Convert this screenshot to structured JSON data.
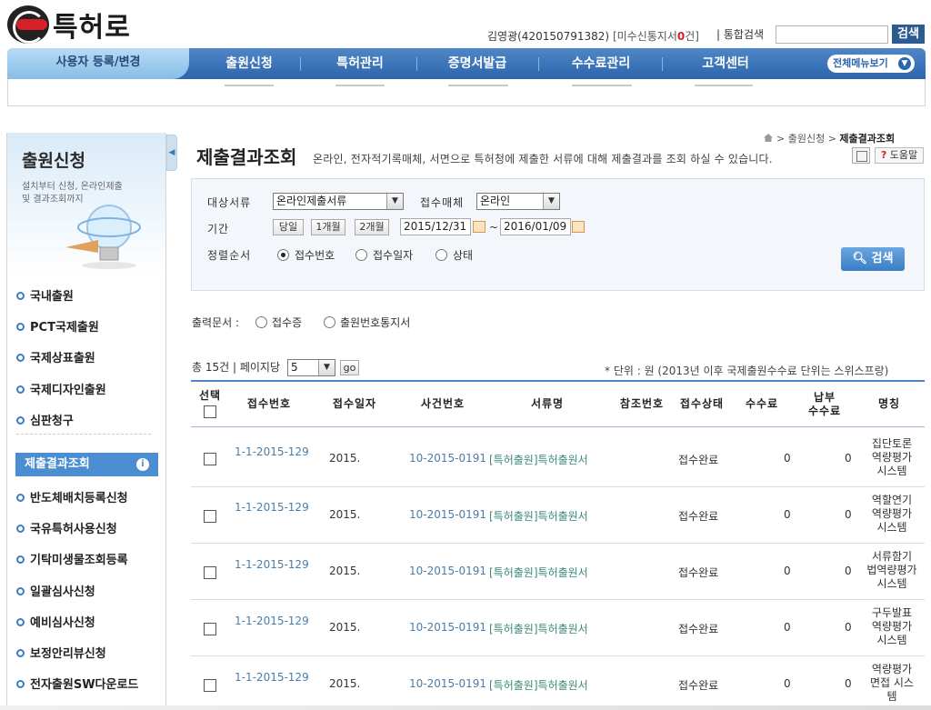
{
  "header": {
    "logo_text": "특허로",
    "user_name": "김영광",
    "user_id": "(420150791382)",
    "unread_label": "[미수신통지서",
    "unread_count": "0",
    "unread_suffix": "건]",
    "search_label": "| 통합검색",
    "search_button": "검색"
  },
  "nav": {
    "items": [
      "사용자 등록/변경",
      "출원신청",
      "특허관리",
      "증명서발급",
      "수수료관리",
      "고객센터"
    ],
    "all_menu": "전체메뉴보기"
  },
  "sidebar": {
    "title": "출원신청",
    "desc_line1": "설치부터 신청, 온라인제출",
    "desc_line2": "및 결과조회까지",
    "items": [
      "국내출원",
      "PCT국제출원",
      "국제상표출원",
      "국제디자인출원",
      "심판청구",
      "제출결과조회",
      "반도체배치등록신청",
      "국유특허사용신청",
      "기탁미생물조회등록",
      "일괄심사신청",
      "예비심사신청",
      "보정안리뷰신청",
      "전자출원SW다운로드"
    ]
  },
  "breadcrumb": {
    "level1": "출원신청",
    "current": "제출결과조회"
  },
  "page": {
    "title": "제출결과조회",
    "description": "온라인, 전자적기록매체, 서면으로 특허청에 제출한 서류에 대해 제출결과를 조회 하실 수 있습니다.",
    "help": "도움말"
  },
  "filter": {
    "doc_type_label": "대상서류",
    "doc_type_value": "온라인제출서류",
    "media_label": "접수매체",
    "media_value": "온라인",
    "period_label": "기간",
    "period_buttons": [
      "당일",
      "1개월",
      "2개월"
    ],
    "date_from": "2015/12/31",
    "date_to": "2016/01/09",
    "tilde": "~",
    "sort_label": "정렬순서",
    "sort_options": [
      "접수번호",
      "접수일자",
      "상태"
    ],
    "sort_selected": "접수번호",
    "search_button": "검색"
  },
  "output": {
    "label": "출력문서 :",
    "options": [
      "접수증",
      "출원번호통지서"
    ]
  },
  "list_meta": {
    "total": "총 15건",
    "per_page_label": "페이지당",
    "per_page_value": "5",
    "go": "go",
    "unit_note": "* 단위 : 원 (2013년 이후 국제출원수수료 단위는 스위스프랑)"
  },
  "table": {
    "headers": [
      "선택",
      "접수번호",
      "접수일자",
      "사건번호",
      "서류명",
      "참조번호",
      "접수상태",
      "수수료",
      "납부\n수수료",
      "명칭"
    ],
    "rows": [
      {
        "receipt_no": "1-1-2015-129",
        "date": "2015.",
        "case_no": "10-2015-0191",
        "doc_name": "[특허출원]특허출원서",
        "status": "접수완료",
        "fee": "0",
        "paid": "0",
        "title": "집단토론\n역량평가\n시스템"
      },
      {
        "receipt_no": "1-1-2015-129",
        "date": "2015.",
        "case_no": "10-2015-0191",
        "doc_name": "[특허출원]특허출원서",
        "status": "접수완료",
        "fee": "0",
        "paid": "0",
        "title": "역할연기\n역량평가\n시스템"
      },
      {
        "receipt_no": "1-1-2015-129",
        "date": "2015.",
        "case_no": "10-2015-0191",
        "doc_name": "[특허출원]특허출원서",
        "status": "접수완료",
        "fee": "0",
        "paid": "0",
        "title": "서류함기\n법역량평가\n시스템"
      },
      {
        "receipt_no": "1-1-2015-129",
        "date": "2015.",
        "case_no": "10-2015-0191",
        "doc_name": "[특허출원]특허출원서",
        "status": "접수완료",
        "fee": "0",
        "paid": "0",
        "title": "구두발표\n역량평가\n시스템"
      },
      {
        "receipt_no": "1-1-2015-129",
        "date": "2015.",
        "case_no": "10-2015-0191",
        "doc_name": "[특허출원]특허출원서",
        "status": "접수완료",
        "fee": "0",
        "paid": "0",
        "title": "역량평가\n면접 시스\n템"
      }
    ]
  },
  "colors": {
    "nav_blue": "#2b65ab",
    "accent_red": "#d61f26",
    "link_blue": "#4a7da8",
    "link_teal": "#3a8a7a"
  }
}
